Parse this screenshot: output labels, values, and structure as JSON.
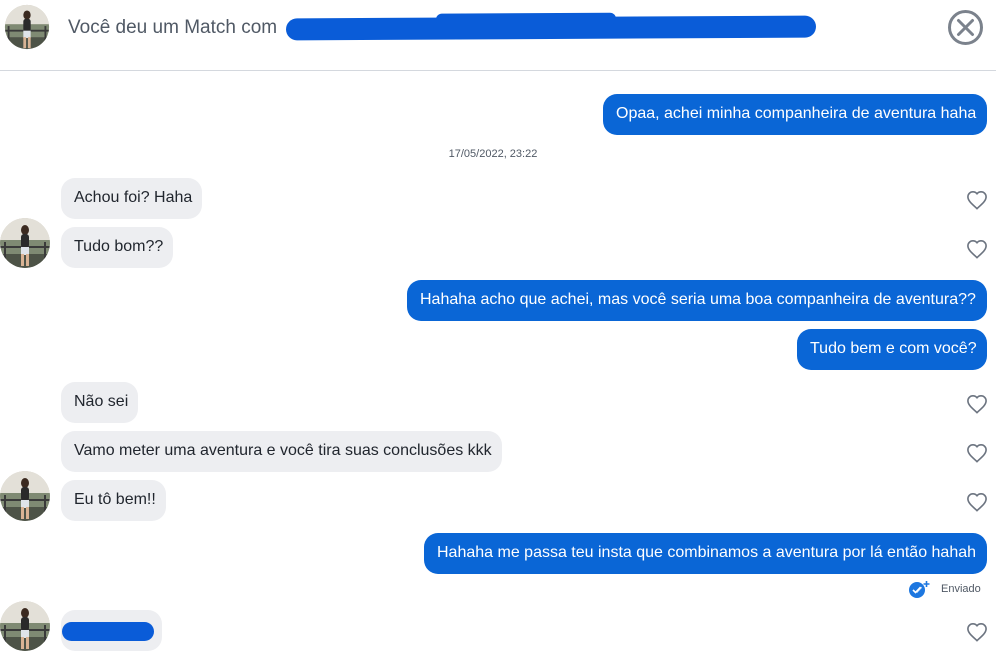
{
  "header": {
    "title": "Você deu um Match com",
    "close_icon": "close-circle-icon"
  },
  "timestamp": "17/05/2022, 23:22",
  "messages": {
    "m1": "Opaa, achei minha companheira de aventura haha",
    "m2": "Achou foi? Haha",
    "m3": "Tudo bom??",
    "m4": "Hahaha acho que achei, mas você seria uma boa companheira de aventura??",
    "m5": "Tudo bem e com você?",
    "m6": "Não sei",
    "m7": "Vamo meter uma aventura e você tira suas conclusões kkk",
    "m8": "Eu tô bem!!",
    "m9": "Hahaha me passa teu insta que combinamos a aventura por lá então hahah",
    "m10": ""
  },
  "status": {
    "sent_label": "Enviado"
  },
  "colors": {
    "outgoing_bubble": "#0a66d6",
    "incoming_bubble": "#edeef1",
    "redaction": "#0a5cd8"
  }
}
